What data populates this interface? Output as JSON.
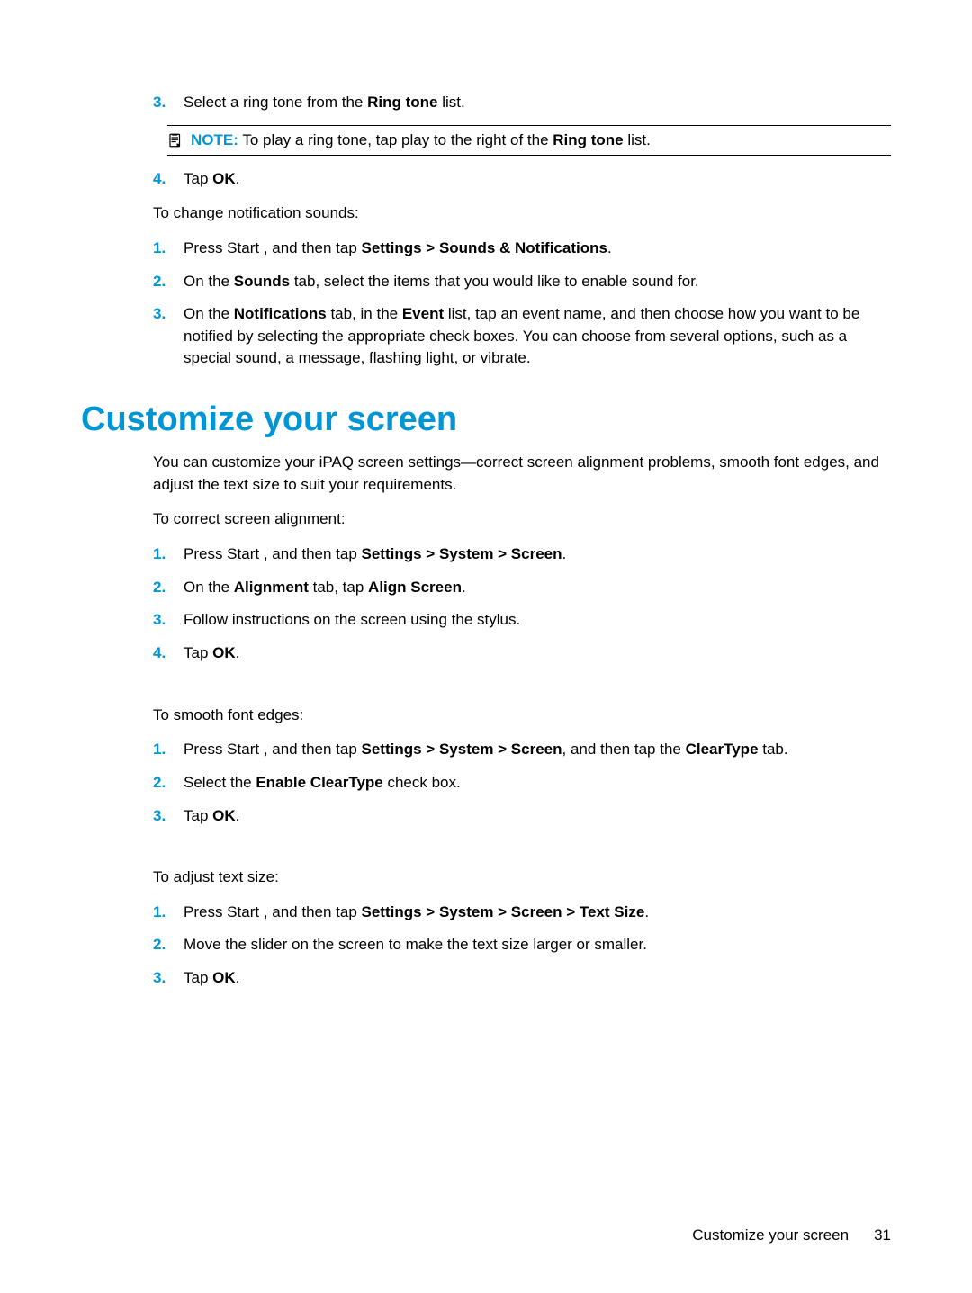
{
  "top_steps": {
    "s3_prefix": "3.",
    "s3_a": "Select a ring tone from the ",
    "s3_b": "Ring tone",
    "s3_c": " list.",
    "note_label": "NOTE:",
    "note_a": "To play a ring tone, tap play ",
    "note_b": " to the right of the ",
    "note_c": "Ring tone",
    "note_d": " list.",
    "s4_prefix": "4.",
    "s4_a": "Tap ",
    "s4_b": "OK",
    "s4_c": "."
  },
  "notif": {
    "intro": "To change notification sounds:",
    "s1_prefix": "1.",
    "s1_a": "Press Start ",
    "s1_b": ", and then tap ",
    "s1_c": "Settings > Sounds & Notifications",
    "s1_d": ".",
    "s2_prefix": "2.",
    "s2_a": "On the ",
    "s2_b": "Sounds",
    "s2_c": " tab, select the items that you would like to enable sound for.",
    "s3_prefix": "3.",
    "s3_a": "On the ",
    "s3_b": "Notifications",
    "s3_c": " tab, in the ",
    "s3_d": "Event",
    "s3_e": " list, tap an event name, and then choose how you want to be notified by selecting the appropriate check boxes. You can choose from several options, such as a special sound, a message, flashing light, or vibrate."
  },
  "section_title": "Customize your screen",
  "section_intro": "You can customize your iPAQ screen settings—correct screen alignment problems, smooth font edges, and adjust the text size to suit your requirements.",
  "align": {
    "intro": "To correct screen alignment:",
    "s1_prefix": "1.",
    "s1_a": "Press Start ",
    "s1_b": ", and then tap ",
    "s1_c": "Settings > System > Screen",
    "s1_d": ".",
    "s2_prefix": "2.",
    "s2_a": "On the ",
    "s2_b": "Alignment",
    "s2_c": " tab, tap ",
    "s2_d": "Align Screen",
    "s2_e": ".",
    "s3_prefix": "3.",
    "s3_a": "Follow instructions on the screen using the stylus.",
    "s4_prefix": "4.",
    "s4_a": "Tap ",
    "s4_b": "OK",
    "s4_c": "."
  },
  "smooth": {
    "intro": "To smooth font edges:",
    "s1_prefix": "1.",
    "s1_a": "Press Start ",
    "s1_b": ", and then tap ",
    "s1_c": "Settings > System > Screen",
    "s1_d": ", and then tap the ",
    "s1_e": "ClearType",
    "s1_f": " tab.",
    "s2_prefix": "2.",
    "s2_a": "Select the ",
    "s2_b": "Enable ClearType",
    "s2_c": " check box.",
    "s3_prefix": "3.",
    "s3_a": "Tap ",
    "s3_b": "OK",
    "s3_c": "."
  },
  "textsize": {
    "intro": "To adjust text size:",
    "s1_prefix": "1.",
    "s1_a": "Press Start ",
    "s1_b": ", and then tap ",
    "s1_c": "Settings > System > Screen > Text Size",
    "s1_d": ".",
    "s2_prefix": "2.",
    "s2_a": "Move the slider on the screen to make the text size larger or smaller.",
    "s3_prefix": "3.",
    "s3_a": "Tap ",
    "s3_b": "OK",
    "s3_c": "."
  },
  "footer": {
    "title": "Customize your screen",
    "page": "31"
  }
}
